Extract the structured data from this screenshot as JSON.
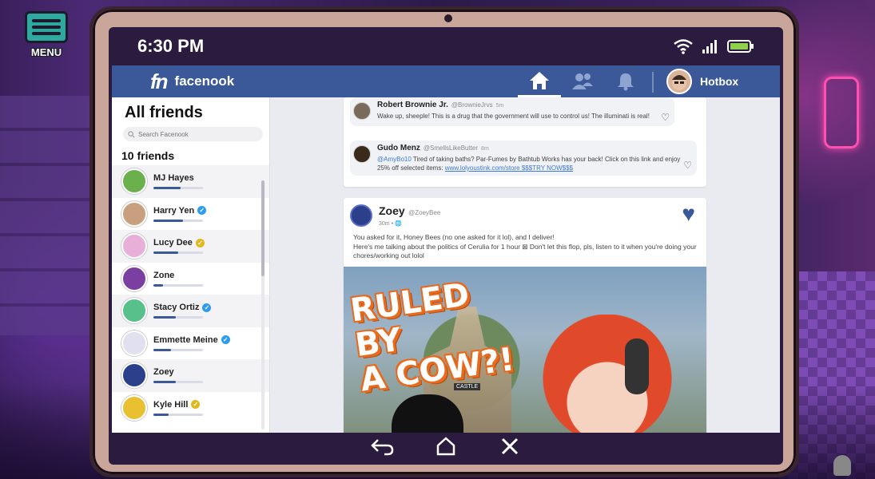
{
  "game": {
    "menu_label": "MENU"
  },
  "status": {
    "time": "6:30 PM"
  },
  "nav": {
    "brand_logo": "fn",
    "brand_name": "facenook",
    "username": "Hotbox"
  },
  "sidebar": {
    "title": "All friends",
    "search_placeholder": "Search Facenook",
    "friends_count": "10 friends",
    "friends": [
      {
        "name": "MJ Hayes",
        "badge": "none",
        "progress": 0.55,
        "color": "#6ab04c"
      },
      {
        "name": "Harry Yen",
        "badge": "blue",
        "progress": 0.6,
        "color": "#c8a080"
      },
      {
        "name": "Lucy Dee",
        "badge": "gold",
        "progress": 0.5,
        "color": "#e8b0d8"
      },
      {
        "name": "Zone",
        "badge": "none",
        "progress": 0.2,
        "color": "#7a3fa0"
      },
      {
        "name": "Stacy Ortiz",
        "badge": "blue",
        "progress": 0.45,
        "color": "#58c08a"
      },
      {
        "name": "Emmette Meine",
        "badge": "blue",
        "progress": 0.35,
        "color": "#e0e0ee"
      },
      {
        "name": "Zoey",
        "badge": "none",
        "progress": 0.45,
        "color": "#2b3f8a"
      },
      {
        "name": "Kyle Hill",
        "badge": "gold",
        "progress": 0.3,
        "color": "#e8c030"
      }
    ]
  },
  "feed": {
    "comments": [
      {
        "name": "Robert Brownie Jr.",
        "handle": "@BrownieJrvs",
        "time": "5m",
        "text": "Wake up, sheeple! This is a drug that the government will use to control us! The illuminati is real!"
      },
      {
        "name": "Gudo Menz",
        "handle": "@SmellsLikeButter",
        "time": "8m",
        "mention": "@AmyBo10",
        "text": " Tired of taking baths? Par-Fumes by Bathtub Works has your back! Click on this link and enjoy 25% off selected items: ",
        "link": "www.lolyoustink.com/store $$$TRY NOW$$$"
      }
    ],
    "post": {
      "name": "Zoey",
      "handle": "@ZoeyBee",
      "time": "30m",
      "line1": "You asked for it, Honey Bees (no one asked for it lol), and I deliver!",
      "line2": "Here's me talking about the politics of Cerulia for 1 hour ⊠ Don't let this flop, pls, listen to it when you're doing your chores/working out lolol",
      "image_headline_1": "RULED BY",
      "image_headline_2": "A COW?!",
      "image_castle_label": "CASTLE"
    }
  }
}
